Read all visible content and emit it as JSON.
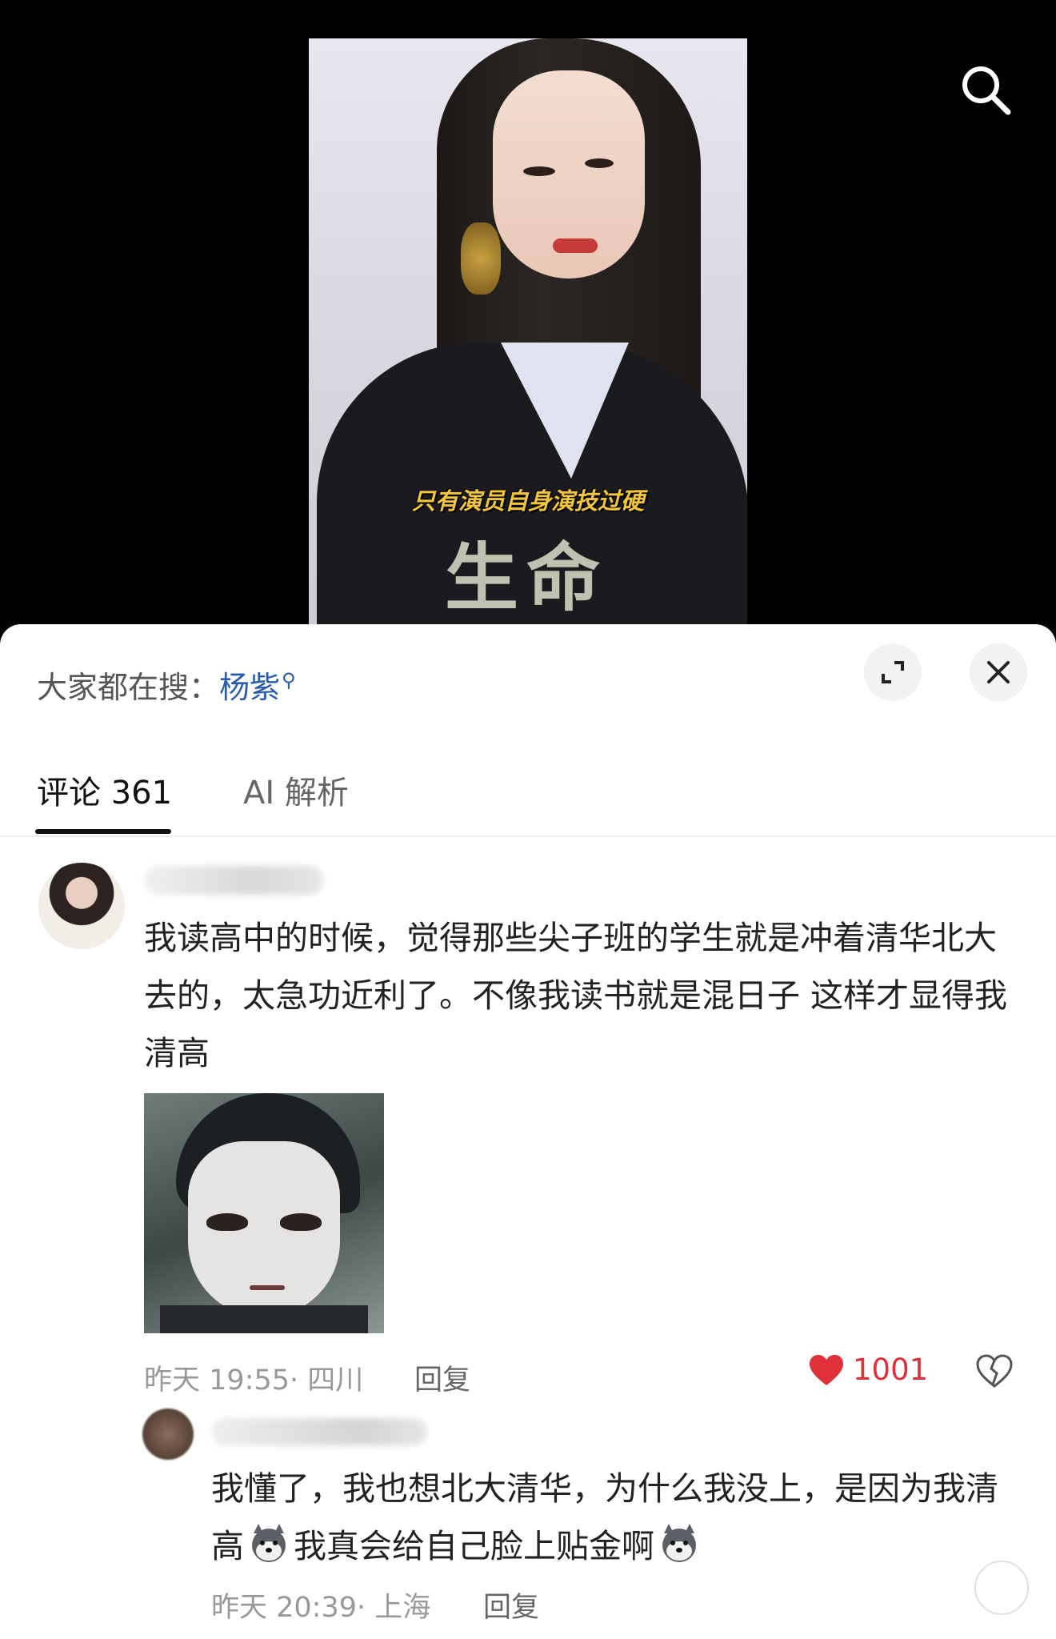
{
  "video": {
    "caption": "只有演员自身演技过硬",
    "logo_text": "生命"
  },
  "header": {
    "search_prefix": "大家都在搜：",
    "search_keyword": "杨紫"
  },
  "tabs": [
    {
      "label": "评论 361",
      "active": true
    },
    {
      "label": "AI 解析",
      "active": false
    }
  ],
  "comments": [
    {
      "text": "我读高中的时候，觉得那些尖子班的学生就是冲着清华北大去的，太急功近利了。不像我读书就是混日子 这样才显得我清高",
      "time_location": "昨天 19:55· 四川",
      "reply_label": "回复",
      "likes": "1001",
      "has_sticker": true
    },
    {
      "text_part1": "我懂了，我也想北大清华，为什么我没上，是因为我清高",
      "text_part2": "我真会给自己脸上贴金啊",
      "time_location": "昨天 20:39· 上海",
      "reply_label": "回复"
    }
  ],
  "colors": {
    "accent_link": "#2a5cad",
    "like_red": "#e0313a",
    "sheet_bg": "#ffffff"
  },
  "icons": [
    "search-icon",
    "expand-icon",
    "close-icon",
    "heart-icon",
    "broken-heart-icon",
    "husky-emoji"
  ]
}
